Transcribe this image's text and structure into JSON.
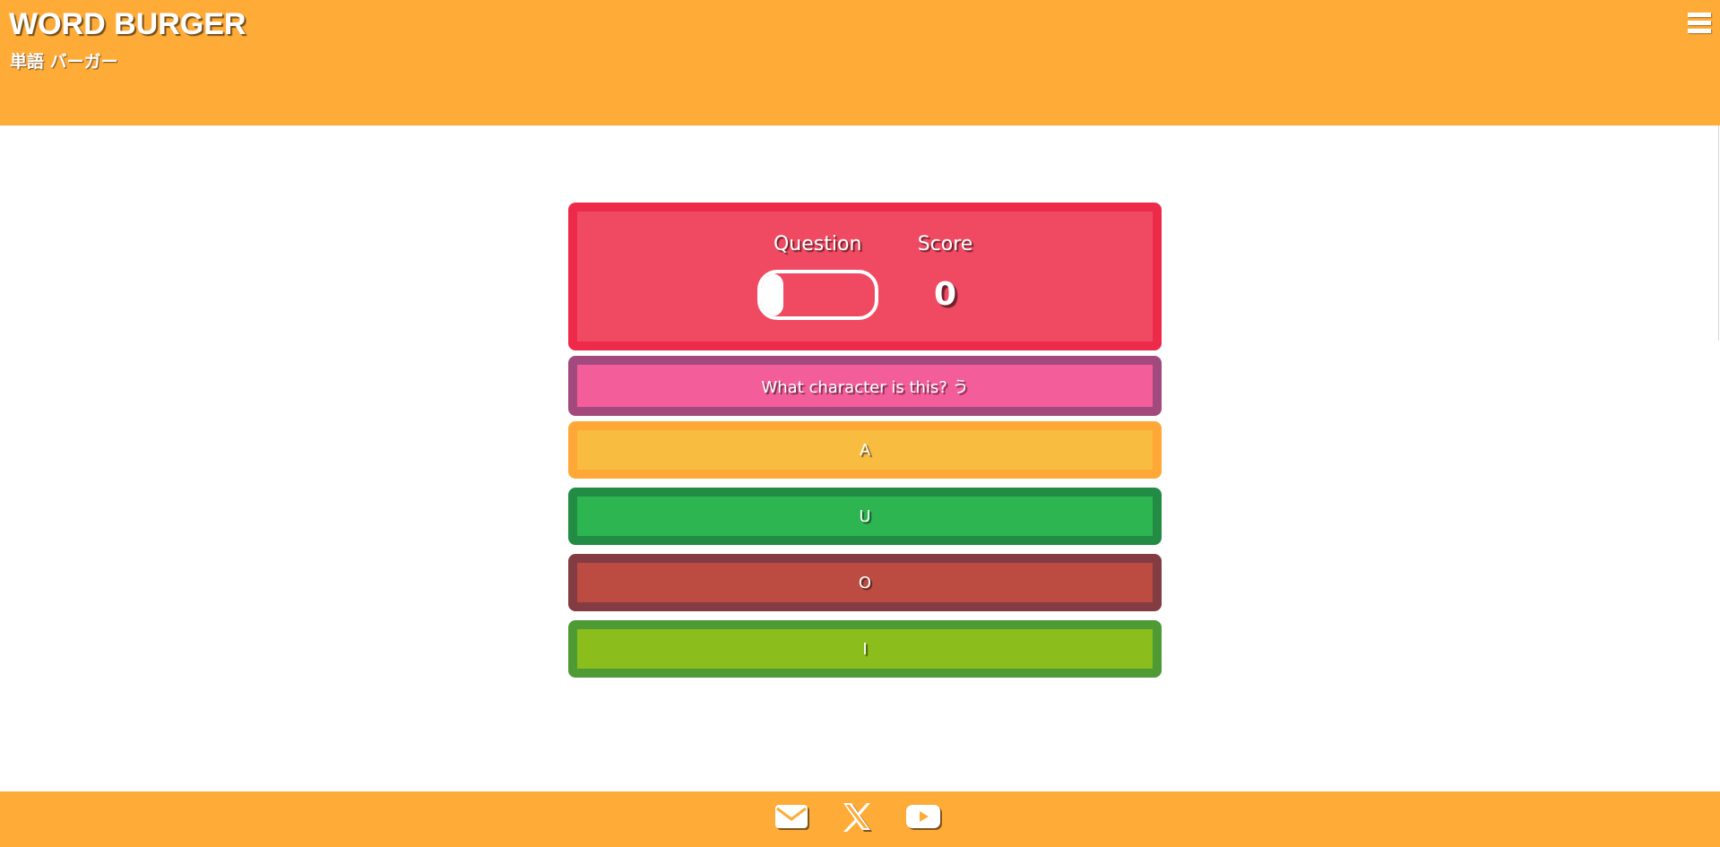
{
  "header": {
    "title": "WORD BURGER",
    "subtitle": "単語 バーガー",
    "menu_icon": "hamburger-menu-icon"
  },
  "stats": {
    "question_label": "Question",
    "score_label": "Score",
    "question_progress": 0.2,
    "score_value": "0"
  },
  "question": {
    "text": "What character is this? う"
  },
  "answers": [
    {
      "label": "A"
    },
    {
      "label": "U"
    },
    {
      "label": "O"
    },
    {
      "label": "I"
    }
  ],
  "footer": {
    "icons": [
      "mail-icon",
      "x-icon",
      "youtube-icon"
    ]
  },
  "colors": {
    "brand": "#ffab38",
    "score_panel": "#ee2a4a",
    "question_panel": "#a24a7e",
    "answer_a": "#f7bc40",
    "answer_u": "#2db552",
    "answer_o": "#bc4c42",
    "answer_i": "#8bbd1c"
  }
}
